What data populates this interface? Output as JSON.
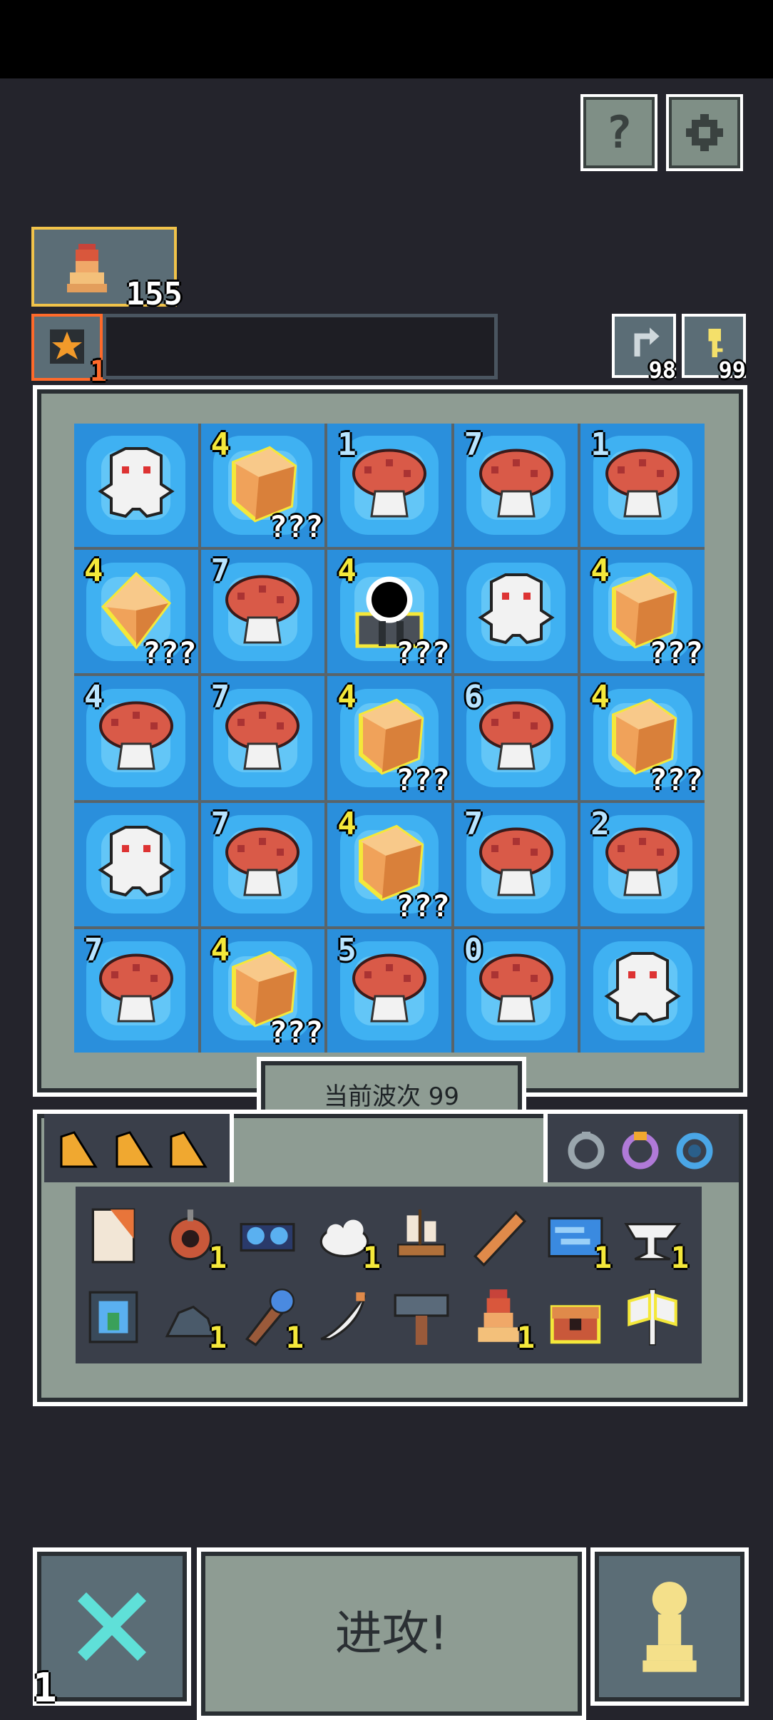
{
  "hud": {
    "hero_count": "155",
    "perk_count": "1",
    "reroll_count": "98",
    "key_count": "99"
  },
  "top_buttons": {
    "help_label": "?",
    "settings_icon": "gear-icon"
  },
  "board": {
    "cells": [
      {
        "type": "ghost",
        "level": "",
        "qqq": ""
      },
      {
        "type": "crystal",
        "level": "4",
        "qqq": "???"
      },
      {
        "type": "mushroom",
        "level": "1",
        "qqq": ""
      },
      {
        "type": "mushroom",
        "level": "7",
        "qqq": ""
      },
      {
        "type": "mushroom",
        "level": "1",
        "qqq": ""
      },
      {
        "type": "gem",
        "level": "4",
        "qqq": "???"
      },
      {
        "type": "mushroom",
        "level": "7",
        "qqq": ""
      },
      {
        "type": "portal",
        "level": "4",
        "qqq": "???"
      },
      {
        "type": "ghost",
        "level": "",
        "qqq": ""
      },
      {
        "type": "crystal",
        "level": "4",
        "qqq": "???"
      },
      {
        "type": "mushroom",
        "level": "4",
        "qqq": ""
      },
      {
        "type": "mushroom",
        "level": "7",
        "qqq": ""
      },
      {
        "type": "crystal",
        "level": "4",
        "qqq": "???"
      },
      {
        "type": "mushroom",
        "level": "6",
        "qqq": ""
      },
      {
        "type": "crystal",
        "level": "4",
        "qqq": "???"
      },
      {
        "type": "ghost",
        "level": "",
        "qqq": ""
      },
      {
        "type": "mushroom",
        "level": "7",
        "qqq": ""
      },
      {
        "type": "crystal",
        "level": "4",
        "qqq": "???"
      },
      {
        "type": "mushroom",
        "level": "7",
        "qqq": ""
      },
      {
        "type": "mushroom",
        "level": "2",
        "qqq": ""
      },
      {
        "type": "mushroom",
        "level": "7",
        "qqq": ""
      },
      {
        "type": "crystal",
        "level": "4",
        "qqq": "???"
      },
      {
        "type": "mushroom",
        "level": "5",
        "qqq": ""
      },
      {
        "type": "mushroom",
        "level": "0",
        "qqq": ""
      },
      {
        "type": "ghost",
        "level": "",
        "qqq": ""
      }
    ]
  },
  "wave": {
    "label": "当前波次 99"
  },
  "inventory": {
    "items": [
      {
        "icon": "scroll-icon",
        "count": ""
      },
      {
        "icon": "eye-bomb-icon",
        "count": "1"
      },
      {
        "icon": "goggles-icon",
        "count": ""
      },
      {
        "icon": "cloud-icon",
        "count": "1"
      },
      {
        "icon": "ship-icon",
        "count": ""
      },
      {
        "icon": "stick-icon",
        "count": ""
      },
      {
        "icon": "wave-icon",
        "count": "1"
      },
      {
        "icon": "anvil-icon",
        "count": "1"
      },
      {
        "icon": "frame-icon",
        "count": ""
      },
      {
        "icon": "rock-icon",
        "count": "1"
      },
      {
        "icon": "staff-icon",
        "count": "1"
      },
      {
        "icon": "feather-icon",
        "count": ""
      },
      {
        "icon": "hammer-icon",
        "count": ""
      },
      {
        "icon": "hero-icon",
        "count": "1"
      },
      {
        "icon": "chest-icon",
        "count": ""
      },
      {
        "icon": "axe-icon",
        "count": ""
      }
    ]
  },
  "bottom": {
    "cancel_count": "1",
    "attack_label": "进攻!"
  }
}
